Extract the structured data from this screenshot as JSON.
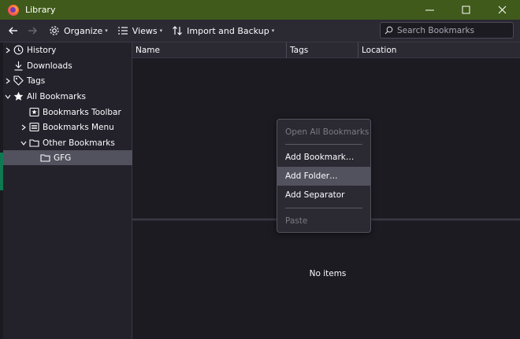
{
  "window": {
    "title": "Library",
    "controls": [
      "minimize-icon",
      "maximize-icon",
      "close-icon"
    ]
  },
  "toolbar": {
    "back_icon": "arrow-left-icon",
    "forward_icon": "arrow-right-icon",
    "organize_label": "Organize",
    "views_label": "Views",
    "import_backup_label": "Import and Backup",
    "search_placeholder": "Search Bookmarks"
  },
  "sidebar": {
    "items": [
      {
        "label": "History",
        "icon": "clock-icon",
        "twisty": "collapsed",
        "indent": 0
      },
      {
        "label": "Downloads",
        "icon": "download-icon",
        "twisty": "none",
        "indent": 0
      },
      {
        "label": "Tags",
        "icon": "tag-icon",
        "twisty": "collapsed",
        "indent": 0
      },
      {
        "label": "All Bookmarks",
        "icon": "star-icon",
        "twisty": "expanded",
        "indent": 0
      },
      {
        "label": "Bookmarks Toolbar",
        "icon": "bookmarks-toolbar-icon",
        "twisty": "none",
        "indent": 1
      },
      {
        "label": "Bookmarks Menu",
        "icon": "bookmarks-menu-icon",
        "twisty": "collapsed",
        "indent": 1
      },
      {
        "label": "Other Bookmarks",
        "icon": "folder-icon",
        "twisty": "expanded",
        "indent": 1
      },
      {
        "label": "GFG",
        "icon": "folder-icon",
        "twisty": "none",
        "indent": 2,
        "selected": true
      }
    ]
  },
  "columns": [
    "Name",
    "Tags",
    "Location"
  ],
  "details": {
    "empty_text": "No items"
  },
  "context_menu": {
    "items": [
      {
        "label": "Open All Bookmarks",
        "state": "disabled"
      },
      {
        "label": "Add Bookmark…",
        "state": "enabled"
      },
      {
        "label": "Add Folder…",
        "state": "hover"
      },
      {
        "label": "Add Separator",
        "state": "enabled"
      },
      {
        "label": "Paste",
        "state": "disabled"
      }
    ]
  },
  "colors": {
    "titlebar": "#3f5a1a",
    "background": "#1c1b22",
    "selection": "#52525e"
  }
}
